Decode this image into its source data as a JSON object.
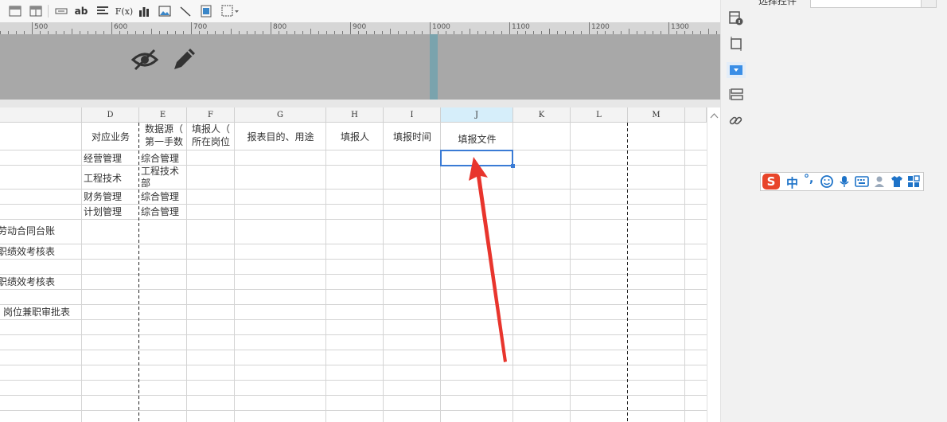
{
  "toolbar": {
    "buttons": [
      {
        "name": "layout-a-icon",
        "label": ""
      },
      {
        "name": "layout-b-icon",
        "label": ""
      },
      {
        "name": "text-field-icon",
        "label": ""
      },
      {
        "name": "text-ab-button",
        "label": "ab"
      },
      {
        "name": "align-icon",
        "label": ""
      },
      {
        "name": "formula-button",
        "label": "F(x)"
      },
      {
        "name": "bar-chart-icon",
        "label": ""
      },
      {
        "name": "image-icon",
        "label": ""
      },
      {
        "name": "line-icon",
        "label": ""
      },
      {
        "name": "frame-icon",
        "label": ""
      },
      {
        "name": "border-icon",
        "label": ""
      }
    ]
  },
  "ruler": {
    "labels": [
      "500",
      "600",
      "700",
      "800",
      "900",
      "1000",
      "1100",
      "1200",
      "1300"
    ]
  },
  "canvas": {
    "icons": [
      "hide-eye-icon",
      "pencil-icon"
    ]
  },
  "grid": {
    "columns": [
      "D",
      "E",
      "F",
      "G",
      "H",
      "I",
      "J",
      "K",
      "L",
      "M"
    ],
    "selected_column": "J",
    "header_row": {
      "D": "对应业务",
      "E_line1": "数据源（",
      "E_line2": "第一手数",
      "F_line1": "填报人（",
      "F_line2": "所在岗位",
      "G": "报表目的、用途",
      "H": "填报人",
      "I": "填报时间",
      "J": "填报文件"
    },
    "rows": [
      {
        "D": "经营管理",
        "E": "综合管理"
      },
      {
        "D": "工程技术",
        "E_line1": "工程技术",
        "E_line2": "部"
      },
      {
        "D": "财务管理",
        "E": "综合管理"
      },
      {
        "D": "计划管理",
        "E": "综合管理"
      }
    ],
    "left_partial_texts": [
      "劳动合同台账",
      "职绩效考核表",
      "职绩效考核表",
      "岗位兼职审批表"
    ]
  },
  "annotation": {
    "color": "#e8352d"
  },
  "right_panel": {
    "partial_label": "选择控件",
    "icons": [
      "widget-settings-icon",
      "crop-frame-icon",
      "dropdown-control-icon",
      "form-layout-icon",
      "link-icon"
    ]
  },
  "ime_bar": {
    "logo": "S",
    "mode_label": "中",
    "punct_label": "°,"
  }
}
